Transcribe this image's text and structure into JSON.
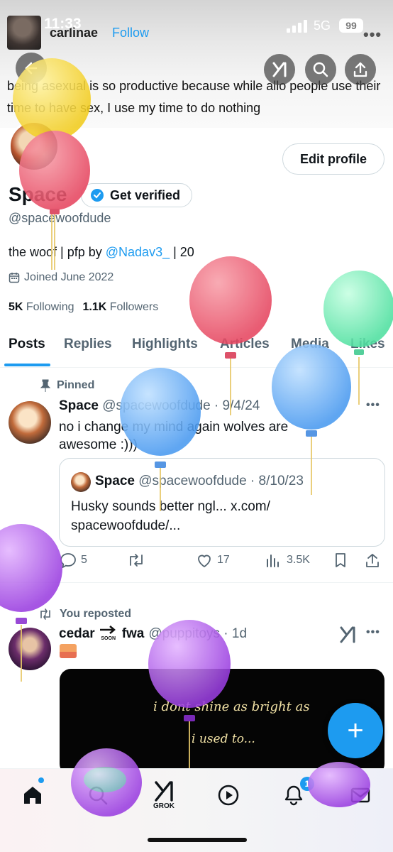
{
  "status_bar": {
    "time": "11:33",
    "network": "5G",
    "battery": "99"
  },
  "header": {
    "previous_tweet_user": "carlinae",
    "follow_label": "Follow",
    "previous_tweet_text": "being asexual is so productive because while allo people use their time to have sex, I use my time to do nothing"
  },
  "profile": {
    "edit_label": "Edit profile",
    "name": "Space",
    "verified_label": "Get verified",
    "handle": "@spacewoofdude",
    "bio_prefix": "the woof | pfp by ",
    "bio_link": "@Nadav3_",
    "bio_suffix": " | 20",
    "joined": "Joined June 2022",
    "following_count": "5K",
    "following_label": "Following",
    "followers_count": "1.1K",
    "followers_label": "Followers"
  },
  "tabs": [
    "Posts",
    "Replies",
    "Highlights",
    "Articles",
    "Media",
    "Likes"
  ],
  "pinned_post": {
    "pinned_label": "Pinned",
    "author": "Space",
    "handle_date": "@spacewoofdude · 9/4/24",
    "text": "no i change my mind again wolves are awesome :)))",
    "quote": {
      "author": "Space",
      "handle_date": "@spacewoofdude · 8/10/23",
      "text": "Husky sounds better ngl... x.com/ spacewoofdude/..."
    },
    "actions": {
      "replies": "5",
      "likes": "17",
      "views": "3.5K"
    }
  },
  "repost": {
    "repost_label": "You reposted",
    "author_part1": "cedar",
    "soon_label": "SOON",
    "author_part2": "fwa",
    "handle_date": "@puppitoys · 1d",
    "media_line1": "i dont shine as bright as",
    "media_line2": "i used to..."
  },
  "bottom_nav": {
    "grok_label": "GROK",
    "notifications_badge": "1"
  },
  "colors": {
    "accent": "#1d9bf0",
    "text": "#0f1419",
    "muted": "#536471"
  }
}
